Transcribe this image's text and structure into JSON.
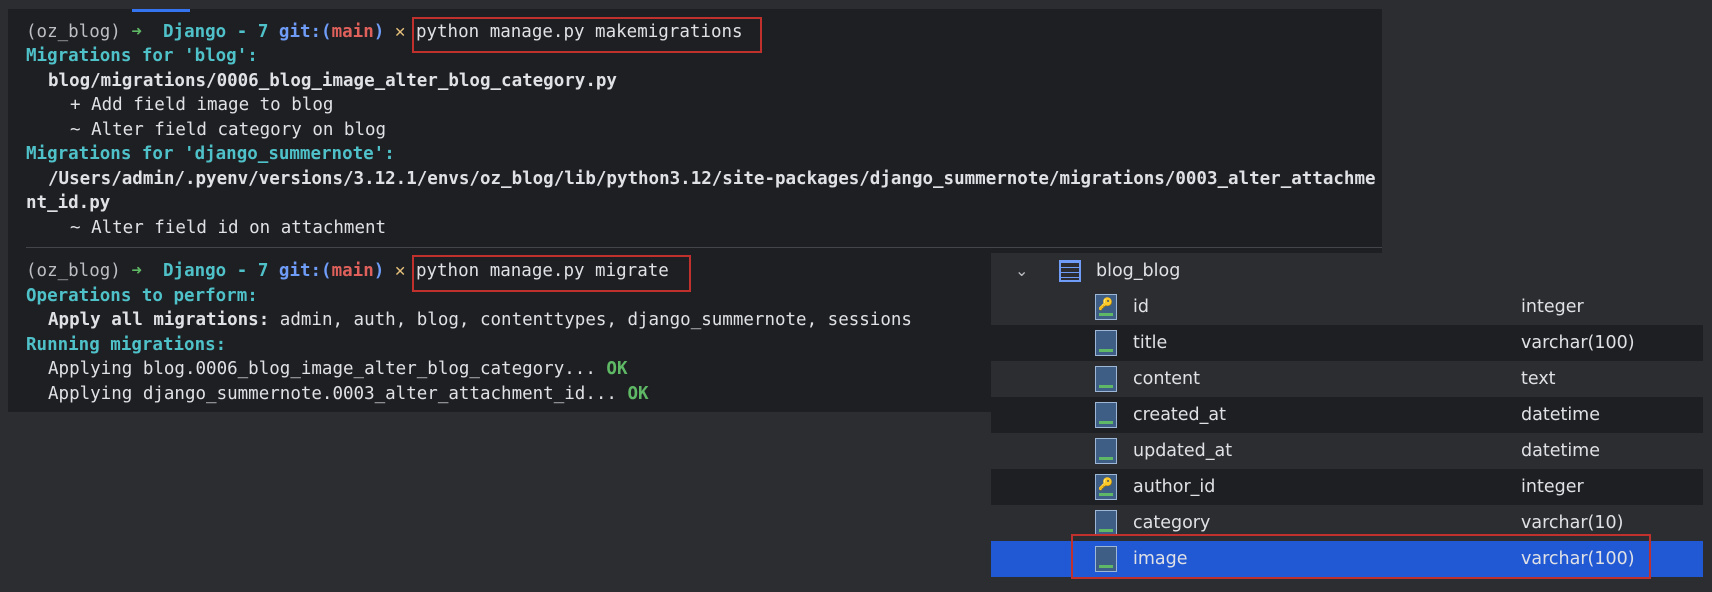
{
  "terminal": {
    "prompt": {
      "env": "(oz_blog)",
      "arrow": "➜",
      "dir": "Django - 7",
      "git_prefix": "git:(",
      "branch": "main",
      "git_suffix": ")",
      "dirty_mark": "✕"
    },
    "commands": [
      "python manage.py makemigrations",
      "python manage.py migrate"
    ],
    "makemigrations_output": {
      "blog_header": "Migrations for 'blog':",
      "blog_file": "blog/migrations/0006_blog_image_alter_blog_category.py",
      "blog_op1": "+ Add field image to blog",
      "blog_op2": "~ Alter field category on blog",
      "summernote_header": "Migrations for 'django_summernote':",
      "summernote_file_line1": "/Users/admin/.pyenv/versions/3.12.1/envs/oz_blog/lib/python3.12/site-packages/django_summernote/migrations/0003_alter_attachme",
      "summernote_file_line2": "nt_id.py",
      "summernote_op1": "~ Alter field id on attachment"
    },
    "migrate_output": {
      "ops_header": "Operations to perform:",
      "apply_label": "Apply all migrations:",
      "apply_list": " admin, auth, blog, contenttypes, django_summernote, sessions",
      "running_header": "Running migrations:",
      "applying1": "Applying blog.0006_blog_image_alter_blog_category... ",
      "applying2": "Applying django_summernote.0003_alter_attachment_id... ",
      "ok": "OK"
    }
  },
  "db_panel": {
    "table_name": "blog_blog",
    "columns": [
      {
        "name": "id",
        "type": "integer"
      },
      {
        "name": "title",
        "type": "varchar(100)"
      },
      {
        "name": "content",
        "type": "text"
      },
      {
        "name": "created_at",
        "type": "datetime"
      },
      {
        "name": "updated_at",
        "type": "datetime"
      },
      {
        "name": "author_id",
        "type": "integer"
      },
      {
        "name": "category",
        "type": "varchar(10)"
      },
      {
        "name": "image",
        "type": "varchar(100)"
      }
    ]
  },
  "icons": {
    "expand": "chevron-down-icon",
    "table": "table-icon",
    "column": "column-icon",
    "primary_key": "primary-key-icon",
    "foreign_key": "foreign-key-icon"
  }
}
